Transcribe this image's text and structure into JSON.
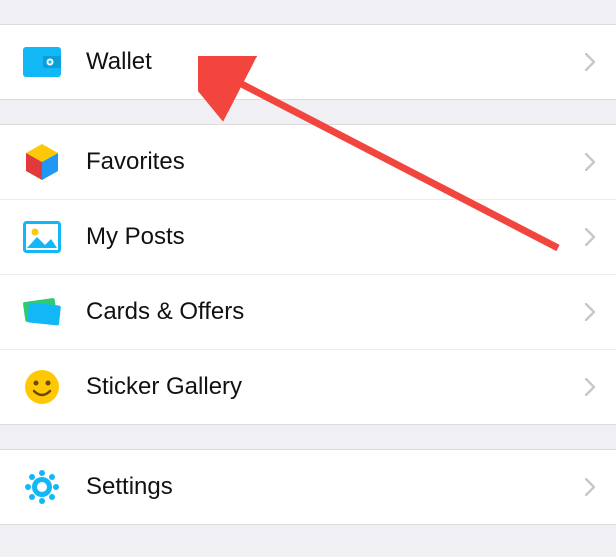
{
  "groups": {
    "g1": {
      "items": {
        "wallet": {
          "label": "Wallet",
          "icon": "wallet-icon"
        }
      }
    },
    "g2": {
      "items": {
        "favorites": {
          "label": "Favorites",
          "icon": "favorites-icon"
        },
        "myposts": {
          "label": "My Posts",
          "icon": "myposts-icon"
        },
        "cards": {
          "label": "Cards & Offers",
          "icon": "cards-icon"
        },
        "stickers": {
          "label": "Sticker Gallery",
          "icon": "sticker-icon"
        }
      }
    },
    "g3": {
      "items": {
        "settings": {
          "label": "Settings",
          "icon": "settings-icon"
        }
      }
    }
  },
  "annotation": {
    "color": "#f2453d",
    "target": "wallet"
  }
}
